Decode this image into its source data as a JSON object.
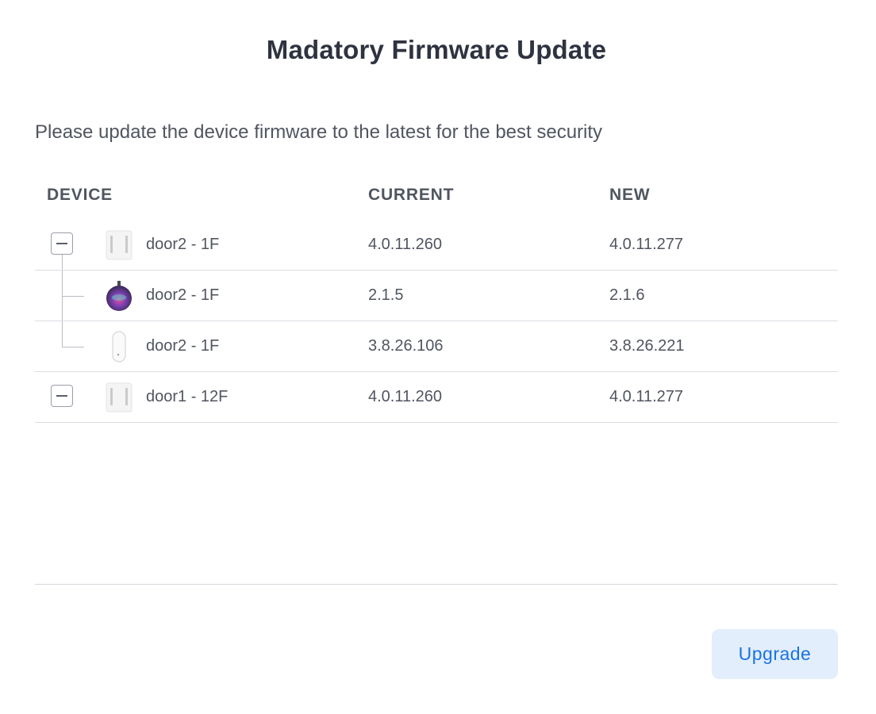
{
  "dialog": {
    "title": "Madatory Firmware Update",
    "subtitle": "Please update the device firmware to the latest for the best security"
  },
  "table": {
    "headers": {
      "device": "DEVICE",
      "current": "CURRENT",
      "new": "NEW"
    },
    "rows": [
      {
        "name": "door2 - 1F",
        "current": "4.0.11.260",
        "new": "4.0.11.277",
        "icon": "door-hub-icon",
        "level": "parent",
        "expanded": true
      },
      {
        "name": "door2 - 1F",
        "current": "2.1.5",
        "new": "2.1.6",
        "icon": "round-reader-icon",
        "level": "child"
      },
      {
        "name": "door2 - 1F",
        "current": "3.8.26.106",
        "new": "3.8.26.221",
        "icon": "door-sensor-icon",
        "level": "child"
      },
      {
        "name": "door1 - 12F",
        "current": "4.0.11.260",
        "new": "4.0.11.277",
        "icon": "door-hub-icon",
        "level": "parent",
        "expanded": true
      }
    ]
  },
  "footer": {
    "upgrade_label": "Upgrade"
  },
  "colors": {
    "accent": "#1a73e0",
    "button_bg": "#e2eefc",
    "divider": "#dcdde3"
  }
}
